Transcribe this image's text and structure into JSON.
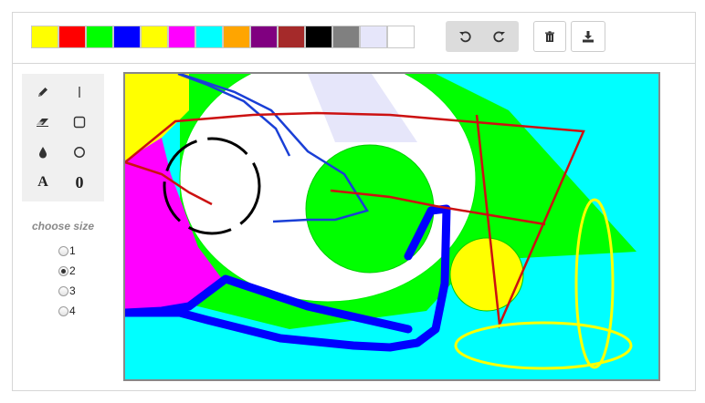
{
  "palette": {
    "colors": [
      "#ffff00",
      "#ff0000",
      "#00ff00",
      "#0000ff",
      "#ffff00",
      "#ff00ff",
      "#00ffff",
      "#ffa500",
      "#800080",
      "#a52a2a",
      "#000000",
      "#808080",
      "#e6e6fa",
      "#ffffff"
    ]
  },
  "toolbar": {
    "undo_icon": "undo-icon",
    "redo_icon": "redo-icon",
    "clear_icon": "trash-icon",
    "download_icon": "download-icon"
  },
  "tools": [
    {
      "name": "pencil",
      "icon": "pencil-icon"
    },
    {
      "name": "line",
      "icon": "line-icon"
    },
    {
      "name": "eraser",
      "icon": "eraser-icon"
    },
    {
      "name": "rectangle",
      "icon": "rectangle-icon"
    },
    {
      "name": "fill",
      "icon": "drop-icon"
    },
    {
      "name": "circle",
      "icon": "circle-icon"
    },
    {
      "name": "text",
      "label": "A"
    },
    {
      "name": "ellipse",
      "label": "0"
    }
  ],
  "size": {
    "title": "choose size",
    "options": [
      "1",
      "2",
      "3",
      "4"
    ],
    "selected": "2"
  }
}
